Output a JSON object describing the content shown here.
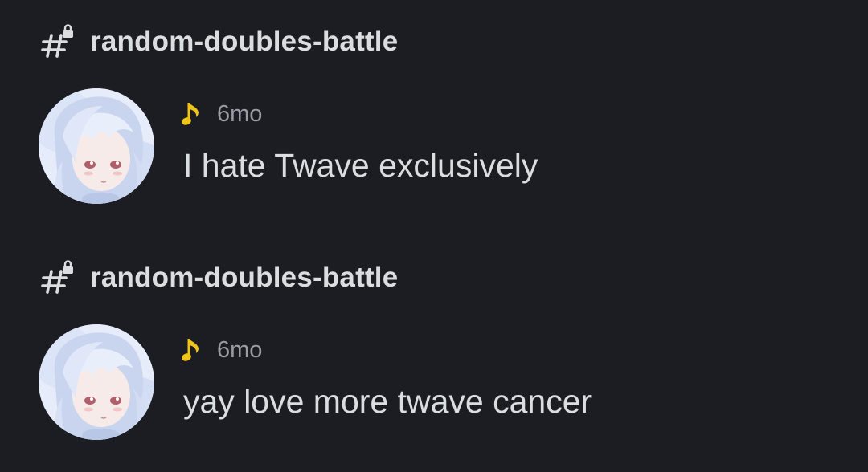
{
  "messages": [
    {
      "channel": "random-doubles-battle",
      "channel_icon": "locked-channel-hash-icon",
      "status_icon": "music-note-icon",
      "status_color": "#f0c419",
      "timestamp": "6mo",
      "text": "I hate Twave exclusively"
    },
    {
      "channel": "random-doubles-battle",
      "channel_icon": "locked-channel-hash-icon",
      "status_icon": "music-note-icon",
      "status_color": "#f0c419",
      "timestamp": "6mo",
      "text": "yay love more twave cancer"
    }
  ]
}
